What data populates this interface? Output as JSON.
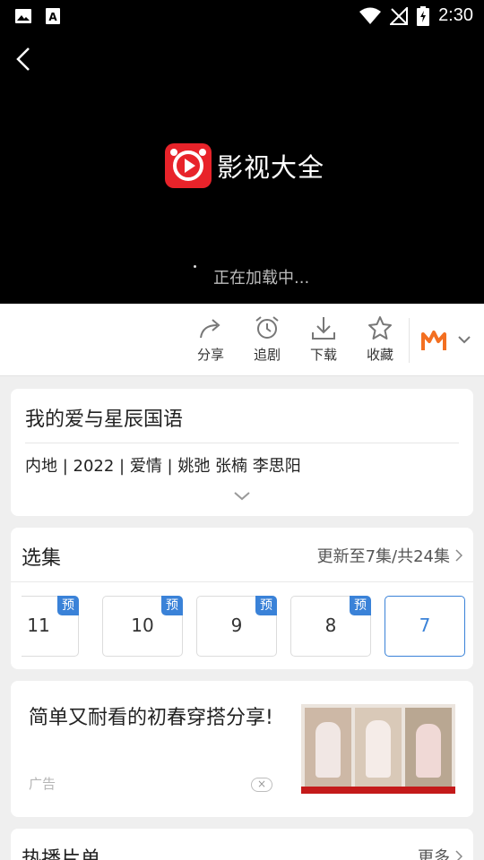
{
  "status": {
    "time": "2:30"
  },
  "player": {
    "logo_text": "影视大全",
    "loading_text": "正在加载中..."
  },
  "actions": {
    "share": "分享",
    "follow": "追剧",
    "download": "下载",
    "favorite": "收藏"
  },
  "info": {
    "title": "我的爱与星辰国语",
    "meta": "内地 | 2022 | 爱情 | 姚弛  张楠  李思阳"
  },
  "episodes": {
    "title": "选集",
    "update": "更新至7集/共24集",
    "list": [
      {
        "num": "11",
        "badge": "预"
      },
      {
        "num": "10",
        "badge": "预"
      },
      {
        "num": "9",
        "badge": "预"
      },
      {
        "num": "8",
        "badge": "预"
      },
      {
        "num": "7",
        "badge": ""
      }
    ]
  },
  "ad": {
    "title": "简单又耐看的初春穿搭分享!",
    "tag": "广告",
    "close": "×"
  },
  "hot": {
    "title": "热播片单",
    "more": "更多"
  },
  "colors": {
    "accent": "#3a82d8",
    "brand_red": "#e8232a",
    "mango_orange": "#f36f21"
  }
}
